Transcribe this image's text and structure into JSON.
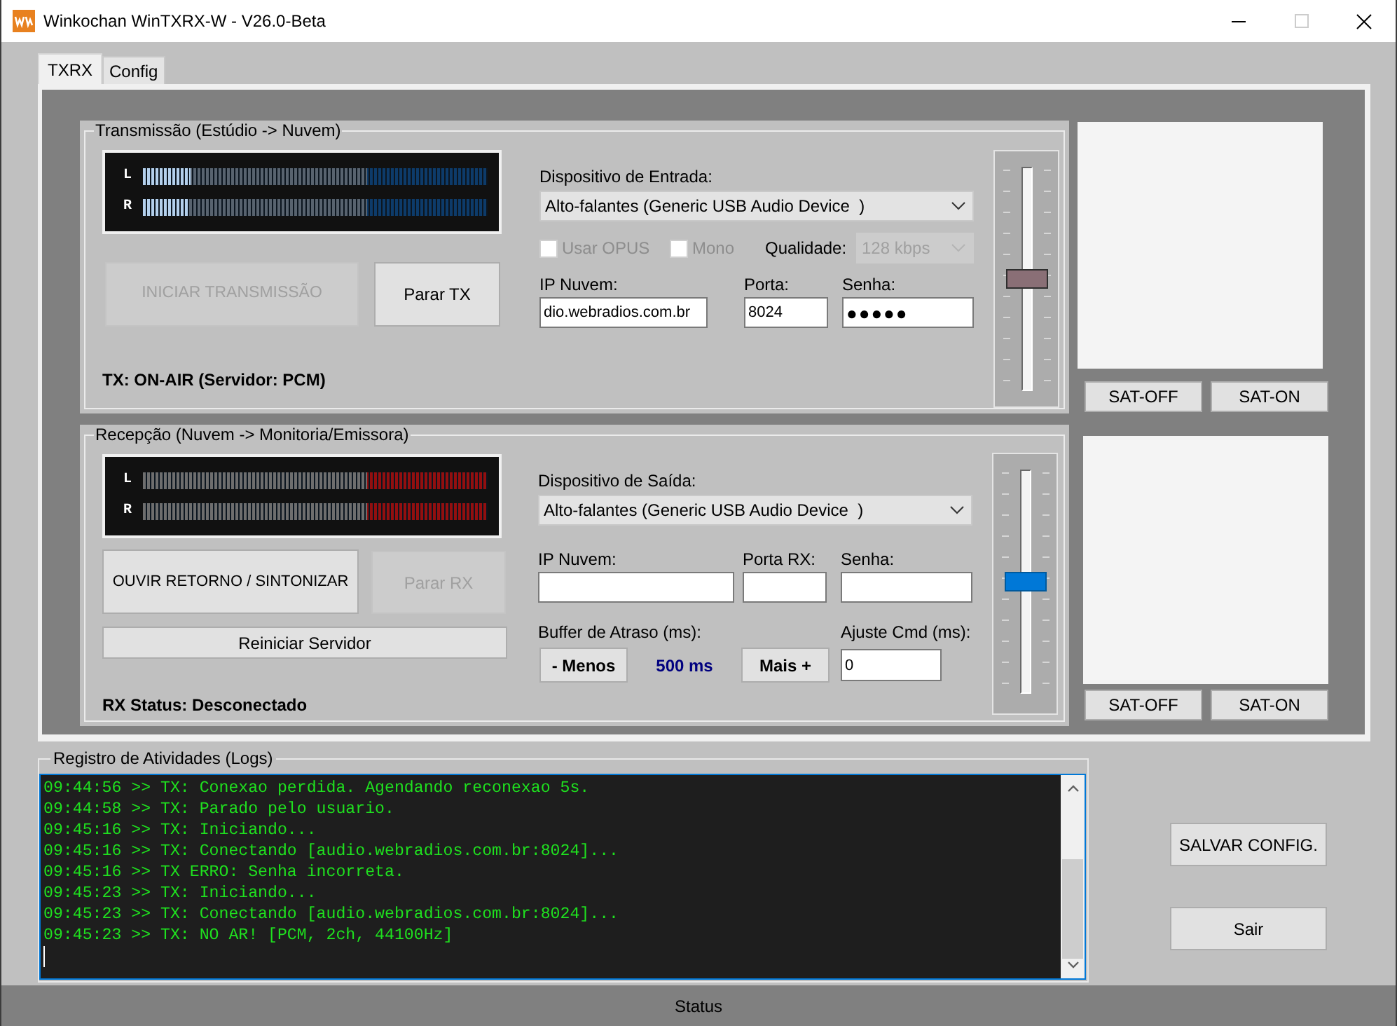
{
  "window": {
    "title": "Winkochan WinTXRX-W - V26.0-Beta",
    "maximize_disabled": true
  },
  "tabs": [
    {
      "label": "TXRX",
      "selected": true
    },
    {
      "label": "Config",
      "selected": false
    }
  ],
  "transmission": {
    "title": "Transmissão (Estúdio -> Nuvem)",
    "meter": [
      {
        "label": "L",
        "level": 0.14
      },
      {
        "label": "R",
        "level": 0.13
      }
    ],
    "buttons": [
      {
        "label": "INICIAR TRANSMISSÃO",
        "disabled": true
      },
      {
        "label": "Parar TX",
        "disabled": false
      }
    ],
    "status": "TX: ON-AIR (Servidor: PCM)",
    "device": {
      "label": "Dispositivo de Entrada:",
      "value": "Alto-falantes (Generic USB Audio Device  )"
    },
    "options": [
      {
        "label": "Usar OPUS",
        "checked": false,
        "disabled": true
      },
      {
        "label": "Mono",
        "checked": false,
        "disabled": true
      }
    ],
    "quality": {
      "label": "Qualidade:",
      "value": "128 kbps",
      "disabled": true
    },
    "fields": [
      {
        "label": "IP Nuvem:",
        "value": "dio.webradios.com.br"
      },
      {
        "label": "Porta:",
        "value": "8024"
      },
      {
        "label": "Senha:",
        "value": "●●●●●"
      }
    ],
    "volume": {
      "level": 0.5,
      "focused": false
    }
  },
  "tx_satellite": {
    "buttons": [
      "SAT-OFF",
      "SAT-ON"
    ]
  },
  "reception": {
    "title": "Recepção (Nuvem -> Monitoria/Emissora)",
    "meter": [
      {
        "label": "L"
      },
      {
        "label": "R"
      }
    ],
    "buttons": [
      {
        "label": "OUVIR RETORNO / SINTONIZAR",
        "disabled": false
      },
      {
        "label": "Parar RX",
        "disabled": true
      }
    ],
    "reset_button": "Reiniciar Servidor",
    "status": "RX Status: Desconectado",
    "device": {
      "label": "Dispositivo de Saída:",
      "value": "Alto-falantes (Generic USB Audio Device  )"
    },
    "fields": [
      {
        "label": "IP Nuvem:"
      },
      {
        "label": "Porta RX:"
      },
      {
        "label": "Senha:"
      }
    ],
    "buffer": {
      "label": "Buffer de Atraso (ms):",
      "decrease": "- Menos",
      "value": "500 ms",
      "increase": "Mais +"
    },
    "adjust": {
      "label": "Ajuste Cmd (ms):",
      "value": "0"
    },
    "volume": {
      "level": 0.5,
      "focused": true
    }
  },
  "rx_satellite": {
    "buttons": [
      "SAT-OFF",
      "SAT-ON"
    ]
  },
  "logs": {
    "title": "Registro de Atividades (Logs)",
    "lines": [
      "09:44:56 >> TX: Conexao perdida. Agendando reconexao 5s.",
      "09:44:58 >> TX: Parado pelo usuario.",
      "09:45:16 >> TX: Iniciando...",
      "09:45:16 >> TX: Conectando [audio.webradios.com.br:8024]...",
      "09:45:16 >> TX ERRO: Senha incorreta.",
      "09:45:23 >> TX: Iniciando...",
      "09:45:23 >> TX: Conectando [audio.webradios.com.br:8024]...",
      "09:45:23 >> TX: NO AR! [PCM, 2ch, 44100Hz]"
    ]
  },
  "actions": [
    "SALVAR CONFIG.",
    "Sair"
  ],
  "status_bar": {
    "text": "Status"
  }
}
